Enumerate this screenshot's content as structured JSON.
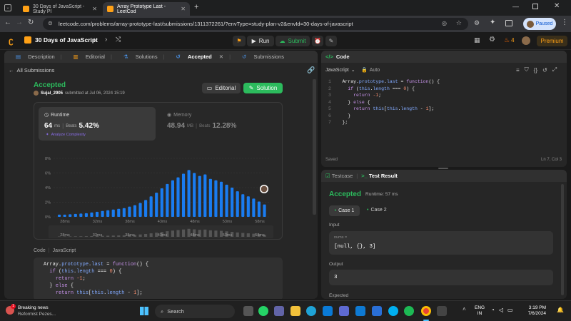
{
  "browser": {
    "tabs": [
      {
        "title": "30 Days of JavaScript - Study Pl"
      },
      {
        "title": "Array Prototype Last - LeetCod"
      }
    ],
    "url": "leetcode.com/problems/array-prototype-last/submissions/1311372261/?envType=study-plan-v2&envId=30-days-of-javascript",
    "profile_label": "Paused"
  },
  "header": {
    "study_plan": "30 Days of JavaScript",
    "run_label": "Run",
    "submit_label": "Submit",
    "streak": "4",
    "premium_label": "Premium"
  },
  "left_tabs": {
    "description": "Description",
    "editorial": "Editorial",
    "solutions": "Solutions",
    "accepted": "Accepted",
    "submissions": "Submissions"
  },
  "submission": {
    "back_label": "All Submissions",
    "status": "Accepted",
    "user": "Sujal_2905",
    "submitted_text": "submitted at Jul 06, 2024 15:19",
    "editorial_btn": "Editorial",
    "solution_btn": "Solution",
    "runtime_label": "Runtime",
    "runtime_value": "64",
    "runtime_unit": "ms",
    "runtime_beats_label": "Beats",
    "runtime_beats": "5.42%",
    "analyze_label": "Analyze Complexity",
    "memory_label": "Memory",
    "memory_value": "48.94",
    "memory_unit": "MB",
    "memory_beats_label": "Beats",
    "memory_beats": "12.28%",
    "code_label": "Code",
    "code_lang": "JavaScript"
  },
  "chart_data": {
    "type": "bar",
    "y_ticks": [
      "8%",
      "6%",
      "4%",
      "2%",
      "0%"
    ],
    "ylim": [
      0,
      8
    ],
    "x_ticks": [
      "28ms",
      "32ms",
      "38ms",
      "43ms",
      "48ms",
      "53ms",
      "58ms"
    ],
    "mini_ticks": [
      "28ms",
      "33ms",
      "38ms",
      "43ms",
      "48ms",
      "53ms",
      "58ms"
    ],
    "values": [
      0.3,
      0.3,
      0.35,
      0.4,
      0.45,
      0.5,
      0.6,
      0.7,
      0.8,
      0.9,
      1.0,
      1.1,
      1.2,
      1.4,
      1.6,
      1.9,
      2.3,
      2.8,
      3.3,
      3.9,
      4.5,
      5.0,
      5.4,
      5.9,
      6.4,
      6.0,
      5.6,
      5.8,
      5.2,
      5.0,
      4.8,
      4.4,
      4.0,
      3.5,
      3.1,
      2.8,
      2.5,
      2.1,
      1.7
    ]
  },
  "editor": {
    "title": "Code",
    "language": "JavaScript",
    "mode": "Auto",
    "lines": [
      "Array.prototype.last = function() {",
      "  if (this.length === 0) {",
      "    return -1;",
      "  } else {",
      "    return this[this.length - 1];",
      "  }",
      "};"
    ],
    "saved_label": "Saved",
    "cursor": "Ln 7, Col 3"
  },
  "result": {
    "testcase_tab": "Testcase",
    "result_tab": "Test Result",
    "status": "Accepted",
    "runtime": "Runtime: 57 ms",
    "case1": "Case 1",
    "case2": "Case 2",
    "input_label": "Input",
    "input_var": "nums =",
    "input_value": "[null, {}, 3]",
    "output_label": "Output",
    "output_value": "3",
    "expected_label": "Expected"
  },
  "taskbar": {
    "news_title": "Breaking news",
    "news_sub": "Reformist Pezes...",
    "search_label": "Search",
    "lang1": "ENG",
    "lang2": "IN",
    "time": "3:19 PM",
    "date": "7/6/2024",
    "badge": "1"
  },
  "colors": {
    "accent": "#ffa116",
    "green": "#2cbb5d",
    "bar": "#1a7cf0"
  }
}
